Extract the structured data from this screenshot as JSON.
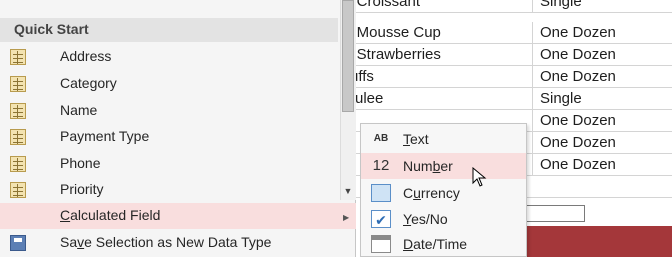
{
  "sheet": {
    "rows": [
      {
        "name": "te Croissant",
        "quantity": "Single"
      },
      {
        "name": "te Mousse Cup",
        "quantity": "One Dozen"
      },
      {
        "name": "te Strawberries",
        "quantity": "One Dozen"
      },
      {
        "name": "Puffs",
        "quantity": "One Dozen"
      },
      {
        "name": "Brulee",
        "quantity": "Single"
      },
      {
        "name": "",
        "quantity": "One Dozen"
      },
      {
        "name": "",
        "quantity": "One Dozen"
      },
      {
        "name": "",
        "quantity": "One Dozen"
      }
    ],
    "search_value": "h",
    "accent_color": "#a4373a"
  },
  "menu": {
    "header": "Quick Start",
    "items": [
      {
        "label": "Address",
        "icon": "table-field-icon"
      },
      {
        "label": "Category",
        "icon": "table-field-icon"
      },
      {
        "label": "Name",
        "icon": "table-field-icon"
      },
      {
        "label": "Payment Type",
        "icon": "table-field-icon"
      },
      {
        "label": "Phone",
        "icon": "table-field-icon"
      },
      {
        "label": "Priority",
        "icon": "table-field-icon"
      }
    ],
    "calculated_field": "Calculated Field",
    "save_selection": "Save Selection as New Data Type",
    "highlight_color": "#f9dede"
  },
  "submenu": {
    "items": [
      {
        "icon_text": "AB",
        "label": "Text",
        "icon": "text-type-icon"
      },
      {
        "icon_text": "12",
        "label": "Number",
        "icon": "number-type-icon"
      },
      {
        "icon_text": "",
        "label": "Currency",
        "icon": "currency-type-icon"
      },
      {
        "icon_text": "✔",
        "label": "Yes/No",
        "icon": "checkbox-type-icon"
      },
      {
        "icon_text": "",
        "label": "Date/Time",
        "icon": "calendar-type-icon"
      }
    ]
  }
}
